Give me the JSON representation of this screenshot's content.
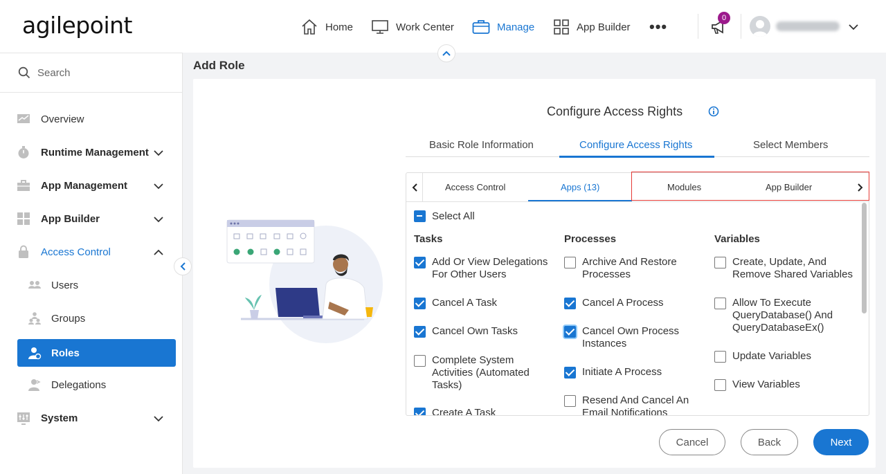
{
  "header": {
    "logo": "agilepoint",
    "nav": [
      {
        "label": "Home",
        "icon": "home-icon"
      },
      {
        "label": "Work Center",
        "icon": "monitor-icon"
      },
      {
        "label": "Manage",
        "icon": "briefcase-icon"
      },
      {
        "label": "App Builder",
        "icon": "grid-icon"
      }
    ],
    "active_nav": "Manage",
    "more_label": "•••",
    "notification_count": "0"
  },
  "sidebar": {
    "search_placeholder": "Search",
    "items": [
      {
        "label": "Overview",
        "icon": "chart-icon"
      },
      {
        "label": "Runtime Management",
        "icon": "stopwatch-icon"
      },
      {
        "label": "App Management",
        "icon": "toolbox-icon"
      },
      {
        "label": "App Builder",
        "icon": "grid-icon"
      },
      {
        "label": "Access Control",
        "icon": "lock-icon"
      },
      {
        "label": "Users",
        "icon": "users-icon"
      },
      {
        "label": "Groups",
        "icon": "groups-icon"
      },
      {
        "label": "Roles",
        "icon": "role-icon"
      },
      {
        "label": "Delegations",
        "icon": "delegation-icon"
      },
      {
        "label": "System",
        "icon": "sliders-icon"
      }
    ]
  },
  "page": {
    "title": "Add Role",
    "section_title": "Configure Access Rights",
    "tabs": [
      "Basic Role Information",
      "Configure Access Rights",
      "Select Members"
    ],
    "subtabs": [
      "Access Control",
      "Apps (13)",
      "Modules",
      "App Builder"
    ],
    "select_all": "Select All",
    "columns": {
      "tasks": {
        "title": "Tasks",
        "items": [
          {
            "label": "Add Or View Delegations For Other Users",
            "checked": true
          },
          {
            "label": "Cancel A Task",
            "checked": true
          },
          {
            "label": "Cancel Own Tasks",
            "checked": true
          },
          {
            "label": "Complete System Activities (Automated Tasks)",
            "checked": false
          },
          {
            "label": "Create A Task",
            "checked": true
          }
        ]
      },
      "processes": {
        "title": "Processes",
        "items": [
          {
            "label": "Archive And Restore Processes",
            "checked": false
          },
          {
            "label": "Cancel A Process",
            "checked": true
          },
          {
            "label": "Cancel Own Process Instances",
            "checked": true
          },
          {
            "label": "Initiate A Process",
            "checked": true
          },
          {
            "label": "Resend And Cancel An Email Notifications",
            "checked": false
          }
        ]
      },
      "variables": {
        "title": "Variables",
        "items": [
          {
            "label": "Create, Update, And Remove Shared Variables",
            "checked": false
          },
          {
            "label": "Allow To Execute QueryDatabase() And QueryDatabaseEx()",
            "checked": false
          },
          {
            "label": "Update Variables",
            "checked": false
          },
          {
            "label": "View Variables",
            "checked": false
          }
        ]
      }
    },
    "buttons": {
      "cancel": "Cancel",
      "back": "Back",
      "next": "Next"
    }
  },
  "colors": {
    "accent": "#1976d2",
    "badge": "#9c1a8c",
    "highlight": "#e53935"
  }
}
